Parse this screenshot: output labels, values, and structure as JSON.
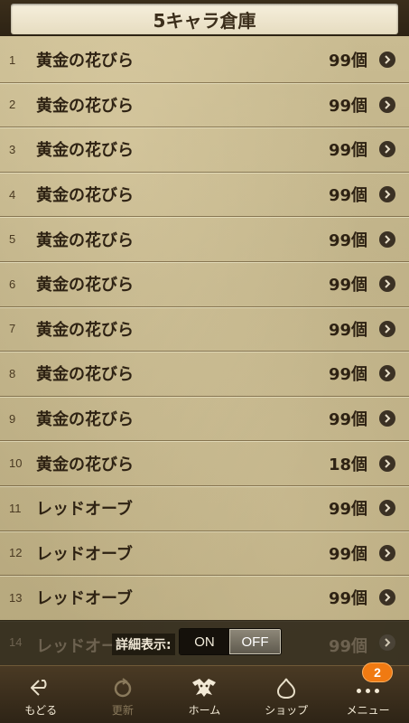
{
  "header": {
    "title": "5キャラ倉庫"
  },
  "items": [
    {
      "num": "1",
      "name": "黄金の花びら",
      "qty": "99個"
    },
    {
      "num": "2",
      "name": "黄金の花びら",
      "qty": "99個"
    },
    {
      "num": "3",
      "name": "黄金の花びら",
      "qty": "99個"
    },
    {
      "num": "4",
      "name": "黄金の花びら",
      "qty": "99個"
    },
    {
      "num": "5",
      "name": "黄金の花びら",
      "qty": "99個"
    },
    {
      "num": "6",
      "name": "黄金の花びら",
      "qty": "99個"
    },
    {
      "num": "7",
      "name": "黄金の花びら",
      "qty": "99個"
    },
    {
      "num": "8",
      "name": "黄金の花びら",
      "qty": "99個"
    },
    {
      "num": "9",
      "name": "黄金の花びら",
      "qty": "99個"
    },
    {
      "num": "10",
      "name": "黄金の花びら",
      "qty": "18個"
    },
    {
      "num": "11",
      "name": "レッドオーブ",
      "qty": "99個"
    },
    {
      "num": "12",
      "name": "レッドオーブ",
      "qty": "99個"
    },
    {
      "num": "13",
      "name": "レッドオーブ",
      "qty": "99個"
    }
  ],
  "partial_item": {
    "num": "14",
    "name": "レッドオー",
    "qty": "99個"
  },
  "detail_toggle": {
    "label": "詳細表示:",
    "on": "ON",
    "off": "OFF",
    "selected": "OFF"
  },
  "nav": {
    "back": {
      "label": "もどる",
      "icon": "back-arrow-icon"
    },
    "refresh": {
      "label": "更新",
      "icon": "refresh-icon"
    },
    "home": {
      "label": "ホーム",
      "icon": "home-dragon-icon"
    },
    "shop": {
      "label": "ショップ",
      "icon": "shop-slime-icon"
    },
    "menu": {
      "label": "メニュー",
      "icon": "more-dots-icon",
      "badge": "2"
    }
  },
  "colors": {
    "badge": "#f07a12",
    "row_text": "#2e2213"
  }
}
